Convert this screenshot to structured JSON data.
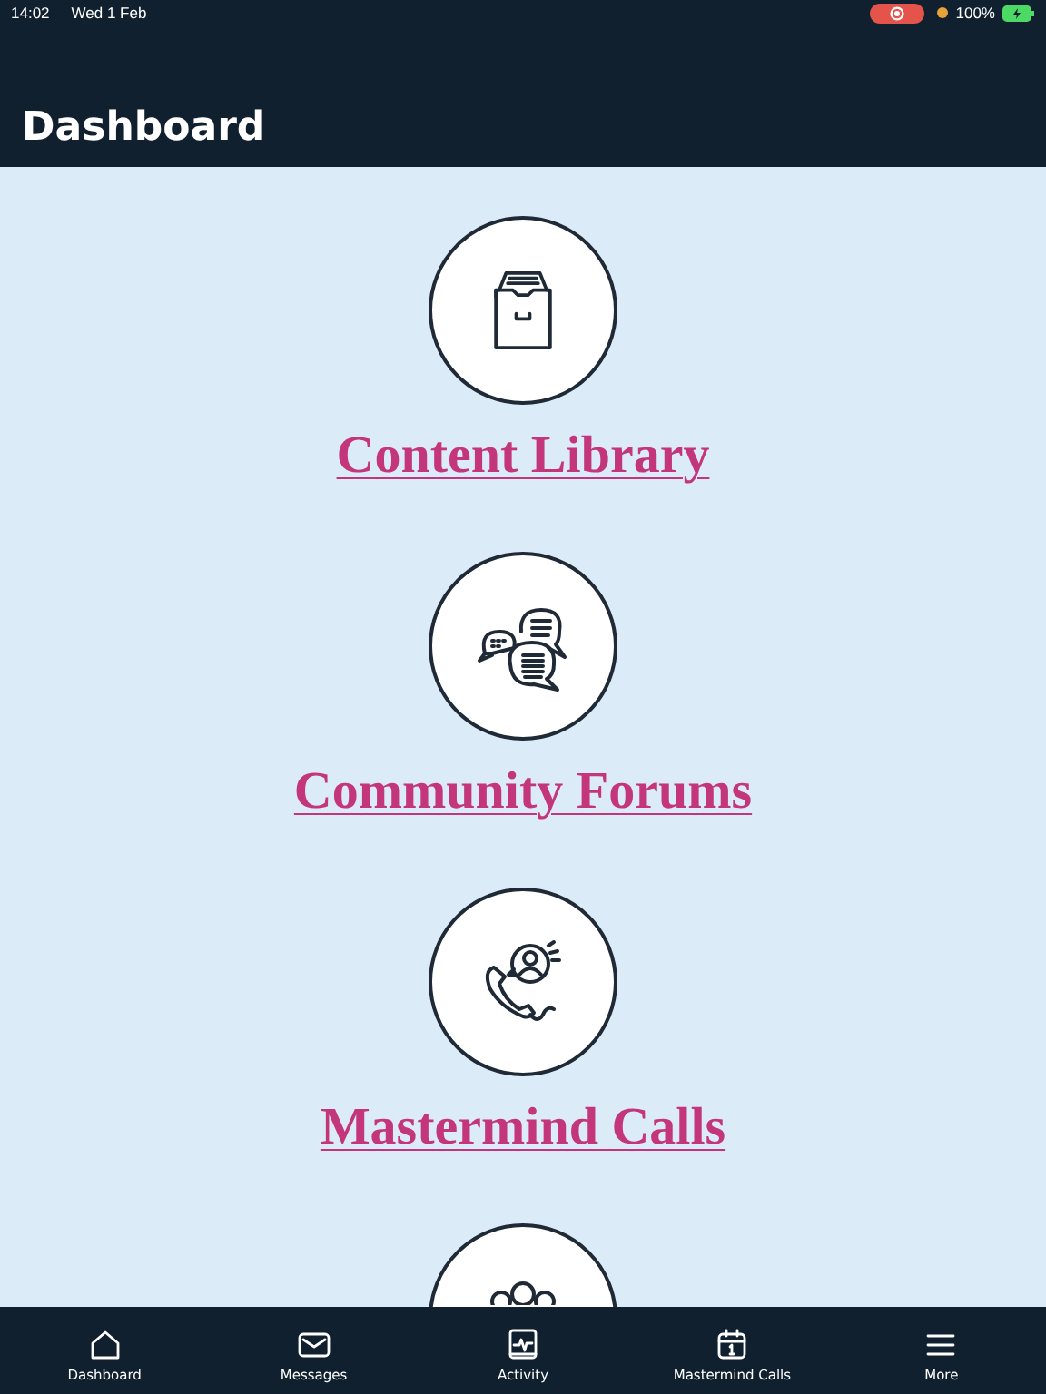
{
  "status_bar": {
    "time": "14:02",
    "date": "Wed 1 Feb",
    "battery": "100%",
    "recording": true
  },
  "header": {
    "title": "Dashboard"
  },
  "items": [
    {
      "kind": "archive",
      "label": "Content Library"
    },
    {
      "kind": "chat",
      "label": "Community Forums"
    },
    {
      "kind": "call",
      "label": "Mastermind Calls"
    },
    {
      "kind": "group"
    }
  ],
  "tab_bar": [
    {
      "kind": "home",
      "label": "Dashboard"
    },
    {
      "kind": "mail",
      "label": "Messages"
    },
    {
      "kind": "activity",
      "label": "Activity"
    },
    {
      "kind": "calendar",
      "label": "Mastermind Calls"
    },
    {
      "kind": "menu",
      "label": "More"
    }
  ]
}
